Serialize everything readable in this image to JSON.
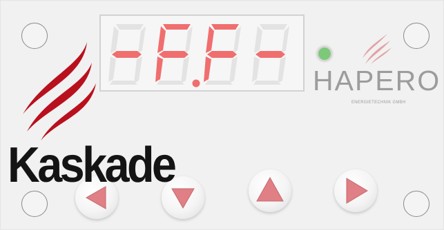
{
  "display": {
    "readout": "-F.F-"
  },
  "status": {
    "led_color": "#7dc97a"
  },
  "brand": {
    "name": "HAPERO",
    "subtitle": "ENERGIETECHNIK GMBH"
  },
  "panel": {
    "label": "Kaskade"
  },
  "buttons": [
    {
      "icon": "arrow-left-icon"
    },
    {
      "icon": "arrow-down-icon"
    },
    {
      "icon": "arrow-up-icon"
    },
    {
      "icon": "arrow-right-icon"
    }
  ],
  "colors": {
    "segment_on": "#f06e6e",
    "segment_off": "#e3e3e3",
    "arrow": "#e07f85",
    "flame": "#b9101d",
    "flame_logo": "#e3a2a6"
  }
}
